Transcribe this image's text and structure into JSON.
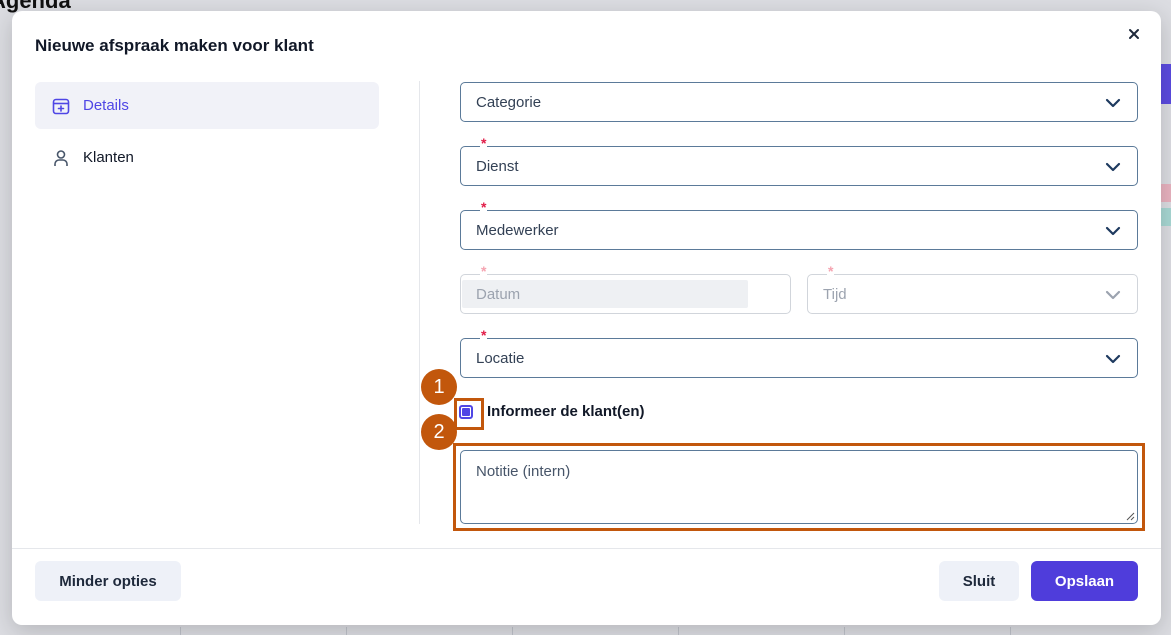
{
  "background": {
    "title": "Agenda"
  },
  "modal": {
    "title": "Nieuwe afspraak maken voor klant",
    "nav": [
      {
        "label": "Details",
        "icon": "calendar-plus-icon",
        "active": true
      },
      {
        "label": "Klanten",
        "icon": "user-icon",
        "active": false
      }
    ],
    "fields": {
      "categorie": {
        "label": "Categorie",
        "required": false
      },
      "dienst": {
        "label": "Dienst",
        "required": true
      },
      "medewerker": {
        "label": "Medewerker",
        "required": true
      },
      "datum": {
        "label": "Datum",
        "required": true,
        "disabled": true
      },
      "tijd": {
        "label": "Tijd",
        "required": true,
        "disabled": true
      },
      "locatie": {
        "label": "Locatie",
        "required": true
      }
    },
    "required_marker": "*",
    "checkbox": {
      "label": "Informeer de klant(en)",
      "checked": true
    },
    "notes": {
      "placeholder": "Notitie (intern)"
    },
    "footer": {
      "less_options": "Minder opties",
      "close": "Sluit",
      "save": "Opslaan"
    }
  },
  "annotations": [
    {
      "number": "1"
    },
    {
      "number": "2"
    }
  ],
  "colors": {
    "accent": "#4f3ddb",
    "required": "#e11d48",
    "annotation": "#c2570c"
  }
}
